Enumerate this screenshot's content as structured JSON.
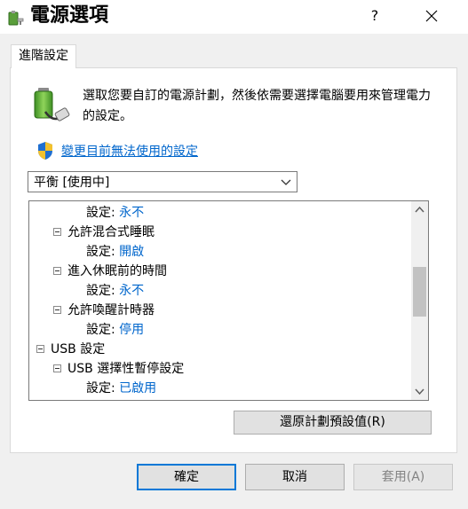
{
  "window": {
    "title": "電源選項",
    "help_label": "?",
    "icon": "power-options-icon"
  },
  "tabs": [
    {
      "label": "進階設定",
      "selected": true
    }
  ],
  "description": "選取您要自訂的電源計劃，然後依需要選擇電腦要用來管理電力的設定。",
  "change_settings_link": "變更目前無法使用的設定",
  "plan_dropdown": {
    "value": "平衡 [使用中]"
  },
  "tree": [
    {
      "label": "設定:",
      "value": "永不"
    },
    {
      "label": "允許混合式睡眠",
      "expanded": true
    },
    {
      "label": "設定:",
      "value": "開啟"
    },
    {
      "label": "進入休眠前的時間",
      "expanded": true
    },
    {
      "label": "設定:",
      "value": "永不"
    },
    {
      "label": "允許喚醒計時器",
      "expanded": true
    },
    {
      "label": "設定:",
      "value": "停用"
    },
    {
      "label": "USB 設定",
      "expanded": true
    },
    {
      "label": "USB 選擇性暫停設定",
      "expanded": true
    },
    {
      "label": "設定:",
      "value": "已啟用"
    }
  ],
  "buttons": {
    "restore": "還原計劃預設值(R)",
    "ok": "確定",
    "cancel": "取消",
    "apply": "套用(A)"
  },
  "colors": {
    "link": "#0066cc",
    "setting_value": "#0066cc",
    "focus_border": "#0078d7"
  }
}
